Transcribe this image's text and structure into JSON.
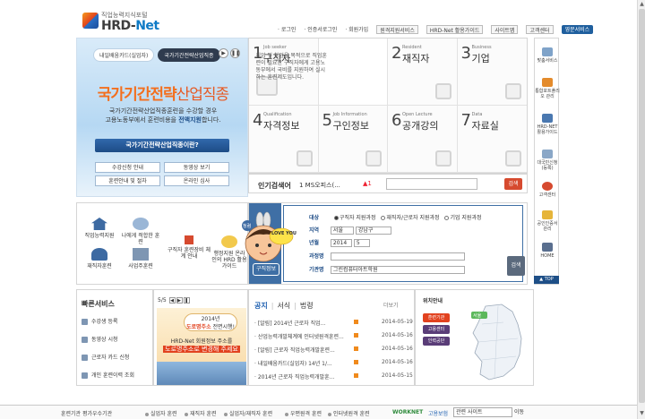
{
  "header": {
    "logo_sub": "직업능력지식포털",
    "logo_main": "HRD-",
    "logo_main2": "Net",
    "nav": [
      "· 로그인",
      "· 인증서로그인",
      "· 회원가입",
      "원격지원서비스",
      "HRD-Net 활용가이드",
      "사이트맵",
      "고객센터",
      "영문서비스"
    ]
  },
  "hero": {
    "tab1": "내일배움카드(실업자)",
    "tab2": "국가기간전략산업직종",
    "title_bold": "국가기간전략",
    "title_light": "산업직종",
    "desc1": "국가기간전략산업직종훈련을 수강할 경우",
    "desc2_pre": "고용노동부에서 훈련비용을 ",
    "desc2_bold": "전액지원",
    "desc2_post": "합니다.",
    "main_button": "국가기간전략산업직종이란?",
    "buttons": [
      "수강신청 안내",
      "동영상 보기",
      "훈련안내 및 절차",
      "온라인 심사"
    ]
  },
  "jobs": [
    {
      "num": "1",
      "en": "Job seeker",
      "ko": "구직자"
    },
    {
      "num": "2",
      "en": "Resident",
      "ko": "재직자"
    },
    {
      "num": "3",
      "en": "Business",
      "ko": "기업"
    },
    {
      "num": "4",
      "en": "Qualification",
      "ko": "자격정보"
    },
    {
      "num": "5",
      "en": "Job Information",
      "ko": "구인정보"
    },
    {
      "num": "6",
      "en": "Open Lecture",
      "ko": "공개강의"
    },
    {
      "num": "7",
      "en": "Data",
      "ko": "자료실"
    }
  ],
  "job_desc": "취업 및 창업을 목적으로 직업훈련이 필요한 구직자에게 고용노동부에서 국비를 지원하여 실시하는 훈련제도입니다.",
  "popular": {
    "label": "인기검색어",
    "rank": "1 MS오피스(...",
    "change": "▲1",
    "button": "검색"
  },
  "services": [
    "직업능력지원",
    "나에게 적합한 훈련",
    "재직자훈련",
    "사업주훈련",
    "구직자 훈련장비 체계 안내",
    "행정지원 온라인의 HRD 활용가이드"
  ],
  "train": {
    "title": "구직정보",
    "row1_label": "대상",
    "radio1": "구직자 지원과정",
    "radio2": "재직자/근로자 지원과정",
    "radio3": "기업 지원과정",
    "row2_label": "지역",
    "region1": "서울",
    "region2": "강남구",
    "row3_label": "년월",
    "year": "2014",
    "month": "5",
    "row4_label": "과정명",
    "row5_label": "기관명",
    "org_value": "그린컴퓨터아트학원",
    "button": "검색"
  },
  "mascot": {
    "badge": "LOVE YOU",
    "tag": "청렴"
  },
  "quick": {
    "title": "빠른서비스",
    "items": [
      "수강생 등록",
      "동영상 시청",
      "근로자 카드 신청",
      "개인 훈련이력 조회"
    ]
  },
  "banner": {
    "page": "5/5",
    "year_line1": "2014년",
    "year_line2_b": "도로명주소",
    "year_line2": " 전면시행!",
    "line1": "HRD-Net 회원정보 주소를",
    "line2": "도로명주소로 변경해 주세요"
  },
  "notice": {
    "tabs": [
      "공지",
      "서식",
      "법령"
    ],
    "more": "더보기",
    "items": [
      {
        "title": "· [알림] 2014년 근로자 직업...",
        "date": "2014-05-19"
      },
      {
        "title": "· 산업능력개발체계에 인터넷원격훈련...",
        "date": "2014-05-16"
      },
      {
        "title": "· [알림] 근로자 직업능력개발훈련...",
        "date": "2014-05-16"
      },
      {
        "title": "· 내일배움카드(실업자) 14년 1/...",
        "date": "2014-05-16"
      },
      {
        "title": "· 2014년 근로자 직업능력개발훈...",
        "date": "2014-05-15"
      }
    ]
  },
  "region": {
    "label": "위치안내",
    "buttons": [
      "훈련기관",
      "고용센터",
      "인력공단"
    ],
    "city": "서울"
  },
  "rail": [
    "맞춤서비스",
    "통합포트폴리오 관리",
    "HRD-NET 활용가이드",
    "대국민신청(등록)",
    "고객센터",
    "공인인증서 관리",
    "HOME"
  ],
  "rail_top": "▲ TOP",
  "footer": {
    "items": [
      "훈련기관 평가우수기관",
      "실업자 훈련",
      "재직자 훈련",
      "실업자/재직자 훈련",
      "우편원격 훈련",
      "인터넷원격 훈련"
    ],
    "logo1": "WORKNET",
    "logo2": "고용보험",
    "site_select": "관련 사이트",
    "go": "이동"
  }
}
